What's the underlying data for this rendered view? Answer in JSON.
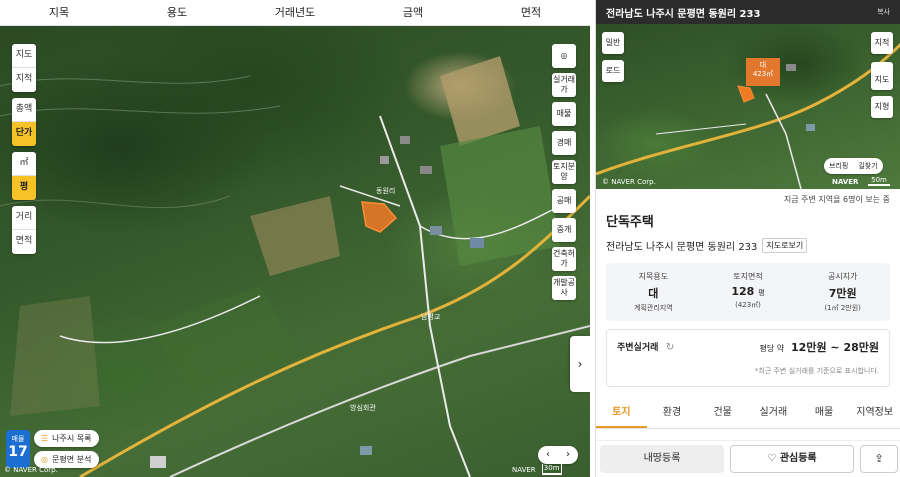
{
  "filters": [
    "지목",
    "용도",
    "거래년도",
    "금액",
    "면적"
  ],
  "map": {
    "left_controls": [
      [
        "지도",
        "지적"
      ],
      [
        "총액",
        "단가"
      ],
      [
        "㎡",
        "평"
      ],
      [
        "거리",
        "면적"
      ]
    ],
    "left_active": [
      "단가",
      "평"
    ],
    "right_controls": [
      "◎",
      "실거래가",
      "매물",
      "경매",
      "토지분양",
      "공매",
      "중개",
      "건축허가",
      "개발공사"
    ],
    "parcel_label": "동원리",
    "road_label": "남평교",
    "station_label": "방심회관",
    "count_badge": {
      "label": "매물",
      "value": "17"
    },
    "chips": [
      {
        "icon": "☰",
        "label": "나주시 목록"
      },
      {
        "icon": "◎",
        "label": "문평면 분석"
      }
    ],
    "naver_logo": "NAVER",
    "scale": "30m",
    "copyright": "© NAVER Corp."
  },
  "panel": {
    "address": "전라남도 나주시 문평면 동원리 233",
    "copy_label": "복사",
    "mini_map": {
      "left_buttons": [
        "일반",
        "로드"
      ],
      "right_buttons": [
        "지적",
        "지도",
        "지형"
      ],
      "marker": {
        "title": "대",
        "area": "423㎡"
      },
      "bottom_tabs": [
        "브리핑",
        "길찾기"
      ],
      "copyright": "© NAVER Corp.",
      "naver": "NAVER",
      "scale": "50m"
    },
    "notice": "지금 주변 지역을 6명이 보는 중",
    "property_type": "단독주택",
    "property_address": "전라남도 나주시 문평면 동원리 233",
    "map_view": "지도로보기",
    "stats": [
      {
        "key": "지목용도",
        "value": "대",
        "unit": "",
        "sub": "계획관리지역"
      },
      {
        "key": "토지면적",
        "value": "128",
        "unit": "평",
        "sub": "(423㎡)"
      },
      {
        "key": "공시지가",
        "value": "7만원",
        "unit": "",
        "sub": "(1㎡ 2만원)"
      }
    ],
    "nearby": {
      "title": "주변실거래",
      "price_prefix": "평당 약",
      "price": "12만원 ~ 28만원",
      "foot": "*최근 주변 실거래를 기준으로 표시합니다."
    },
    "tabs": [
      "토지",
      "환경",
      "건물",
      "실거래",
      "매물",
      "지역정보"
    ],
    "active_tab": "토지",
    "actions": {
      "register": "내땅등록",
      "favorite": "관심등록",
      "share_icon": "share-icon"
    }
  }
}
